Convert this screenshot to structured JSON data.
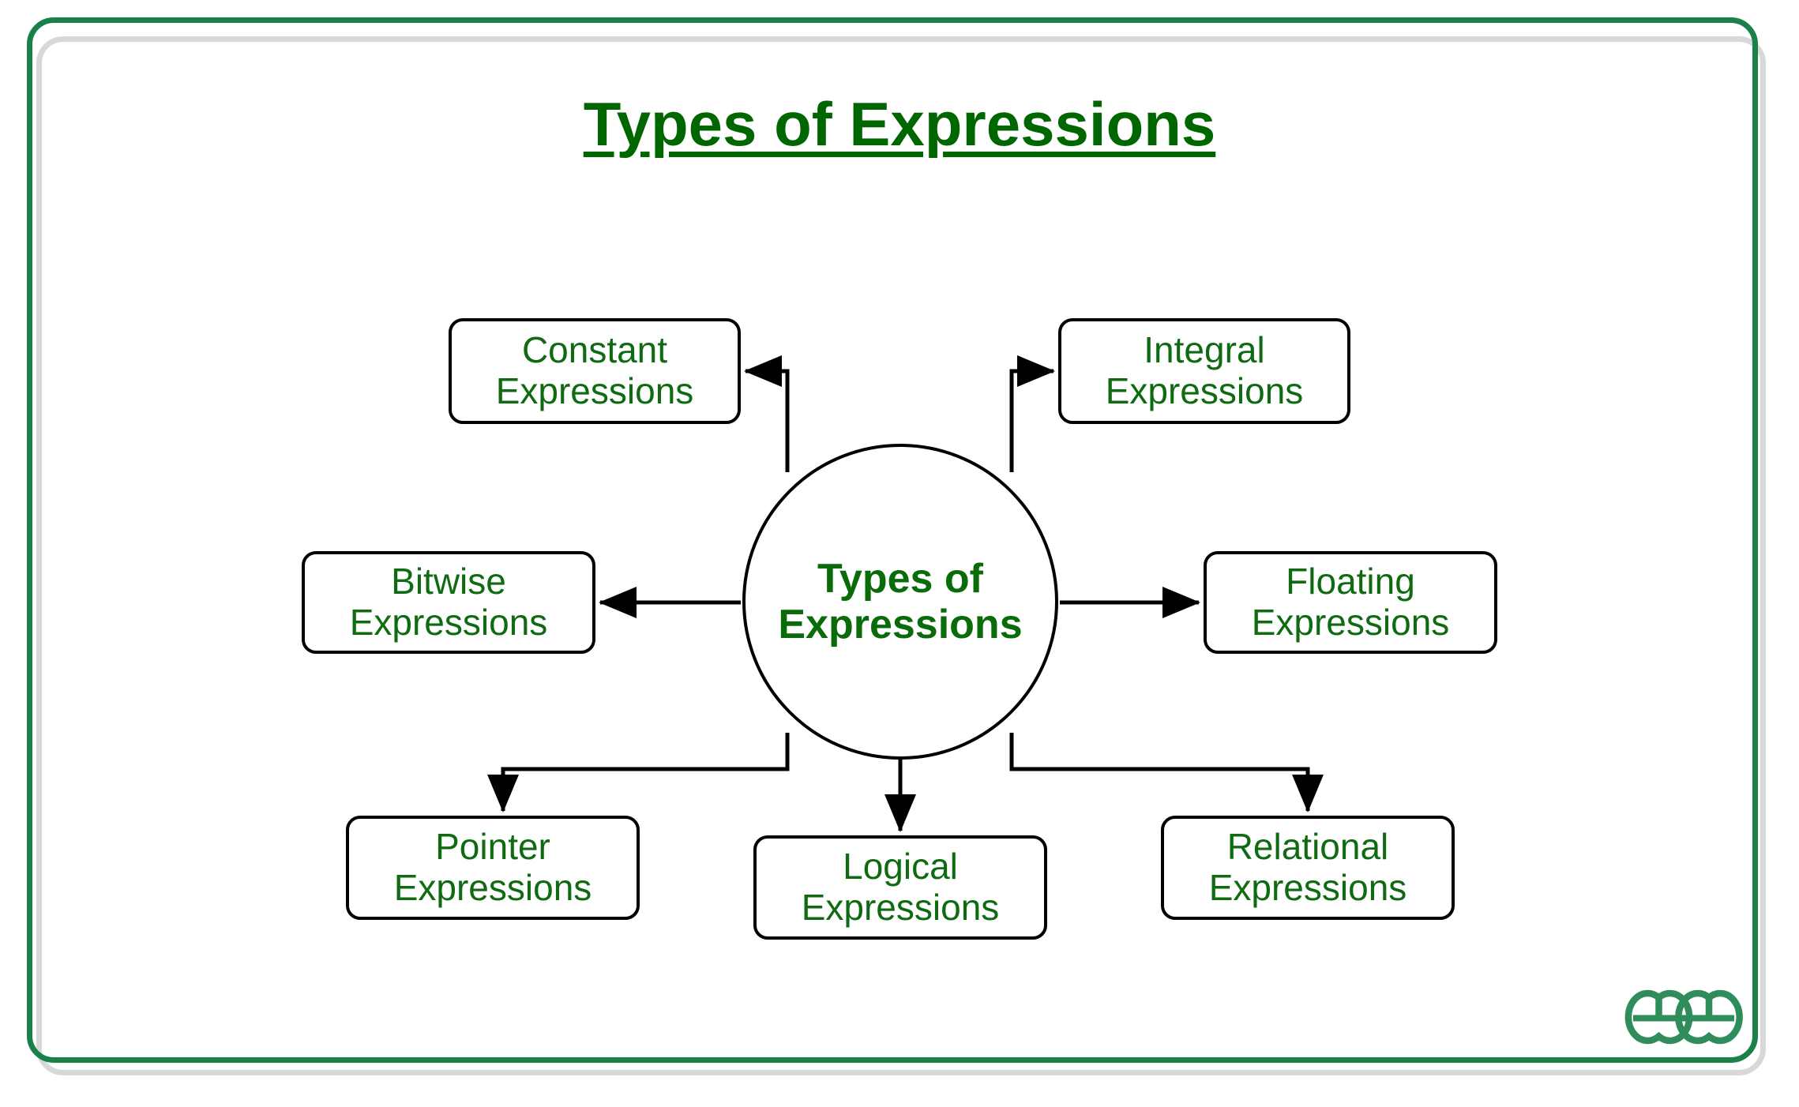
{
  "page": {
    "title": "Types of Expressions",
    "background_color": "#ffffff",
    "frame_border_color": "#1a8049",
    "frame_shadow_color": "#d8d8d8"
  },
  "diagram": {
    "type": "hub-and-spoke",
    "accent_color": "#0f6b12",
    "title_color": "#006600",
    "connector_color": "#000000",
    "hub": {
      "label": "Types of\nExpressions",
      "shape": "circle"
    },
    "nodes": [
      {
        "id": "constant",
        "label": "Constant\nExpressions",
        "position": "top-left",
        "arrow": "left"
      },
      {
        "id": "integral",
        "label": "Integral\nExpressions",
        "position": "top-right",
        "arrow": "right"
      },
      {
        "id": "bitwise",
        "label": "Bitwise\nExpressions",
        "position": "middle-left",
        "arrow": "left"
      },
      {
        "id": "floating",
        "label": "Floating\nExpressions",
        "position": "middle-right",
        "arrow": "right"
      },
      {
        "id": "pointer",
        "label": "Pointer\nExpressions",
        "position": "bottom-left",
        "arrow": "down"
      },
      {
        "id": "logical",
        "label": "Logical\nExpressions",
        "position": "bottom-center",
        "arrow": "down"
      },
      {
        "id": "relational",
        "label": "Relational\nExpressions",
        "position": "bottom-right",
        "arrow": "down"
      }
    ]
  },
  "branding": {
    "logo_name": "geeksforgeeks-logo",
    "logo_color": "#2f8d5b"
  }
}
